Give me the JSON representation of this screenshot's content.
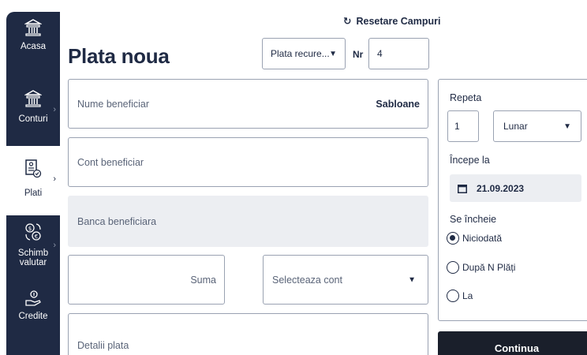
{
  "sidebar": {
    "items": [
      {
        "label": "Acasa",
        "icon": "bank-icon"
      },
      {
        "label": "Conturi",
        "icon": "bank-icon"
      },
      {
        "label": "Plati",
        "icon": "payment-document-icon"
      },
      {
        "label": "Schimb valutar",
        "icon": "currency-exchange-icon"
      },
      {
        "label": "Credite",
        "icon": "loan-hand-coin-icon"
      }
    ],
    "active": "Plati"
  },
  "header": {
    "reset_label": "Resetare Campuri",
    "title": "Plata noua",
    "recurrence_select": "Plata recure...",
    "nr_label": "Nr",
    "nr_value": "4"
  },
  "form": {
    "beneficiary_name_placeholder": "Nume beneficiar",
    "templates_link": "Sabloane",
    "beneficiary_account_placeholder": "Cont beneficiar",
    "beneficiary_bank_placeholder": "Banca beneficiara",
    "amount_placeholder": "Suma",
    "account_select_placeholder": "Selecteaza cont",
    "payment_details_placeholder": "Detalii plata"
  },
  "recurrence": {
    "repeat_label": "Repeta",
    "repeat_count": "1",
    "repeat_unit": "Lunar",
    "start_label": "Începe la",
    "start_date": "21.09.2023",
    "end_label": "Se încheie",
    "end_options": [
      "Niciodată",
      "După N Plăți",
      "La"
    ],
    "end_selected": "Niciodată"
  },
  "continue_label": "Continua",
  "colors": {
    "primary": "#1f2a44",
    "button": "#1a1f2b",
    "disabled_field": "#eceef2"
  }
}
